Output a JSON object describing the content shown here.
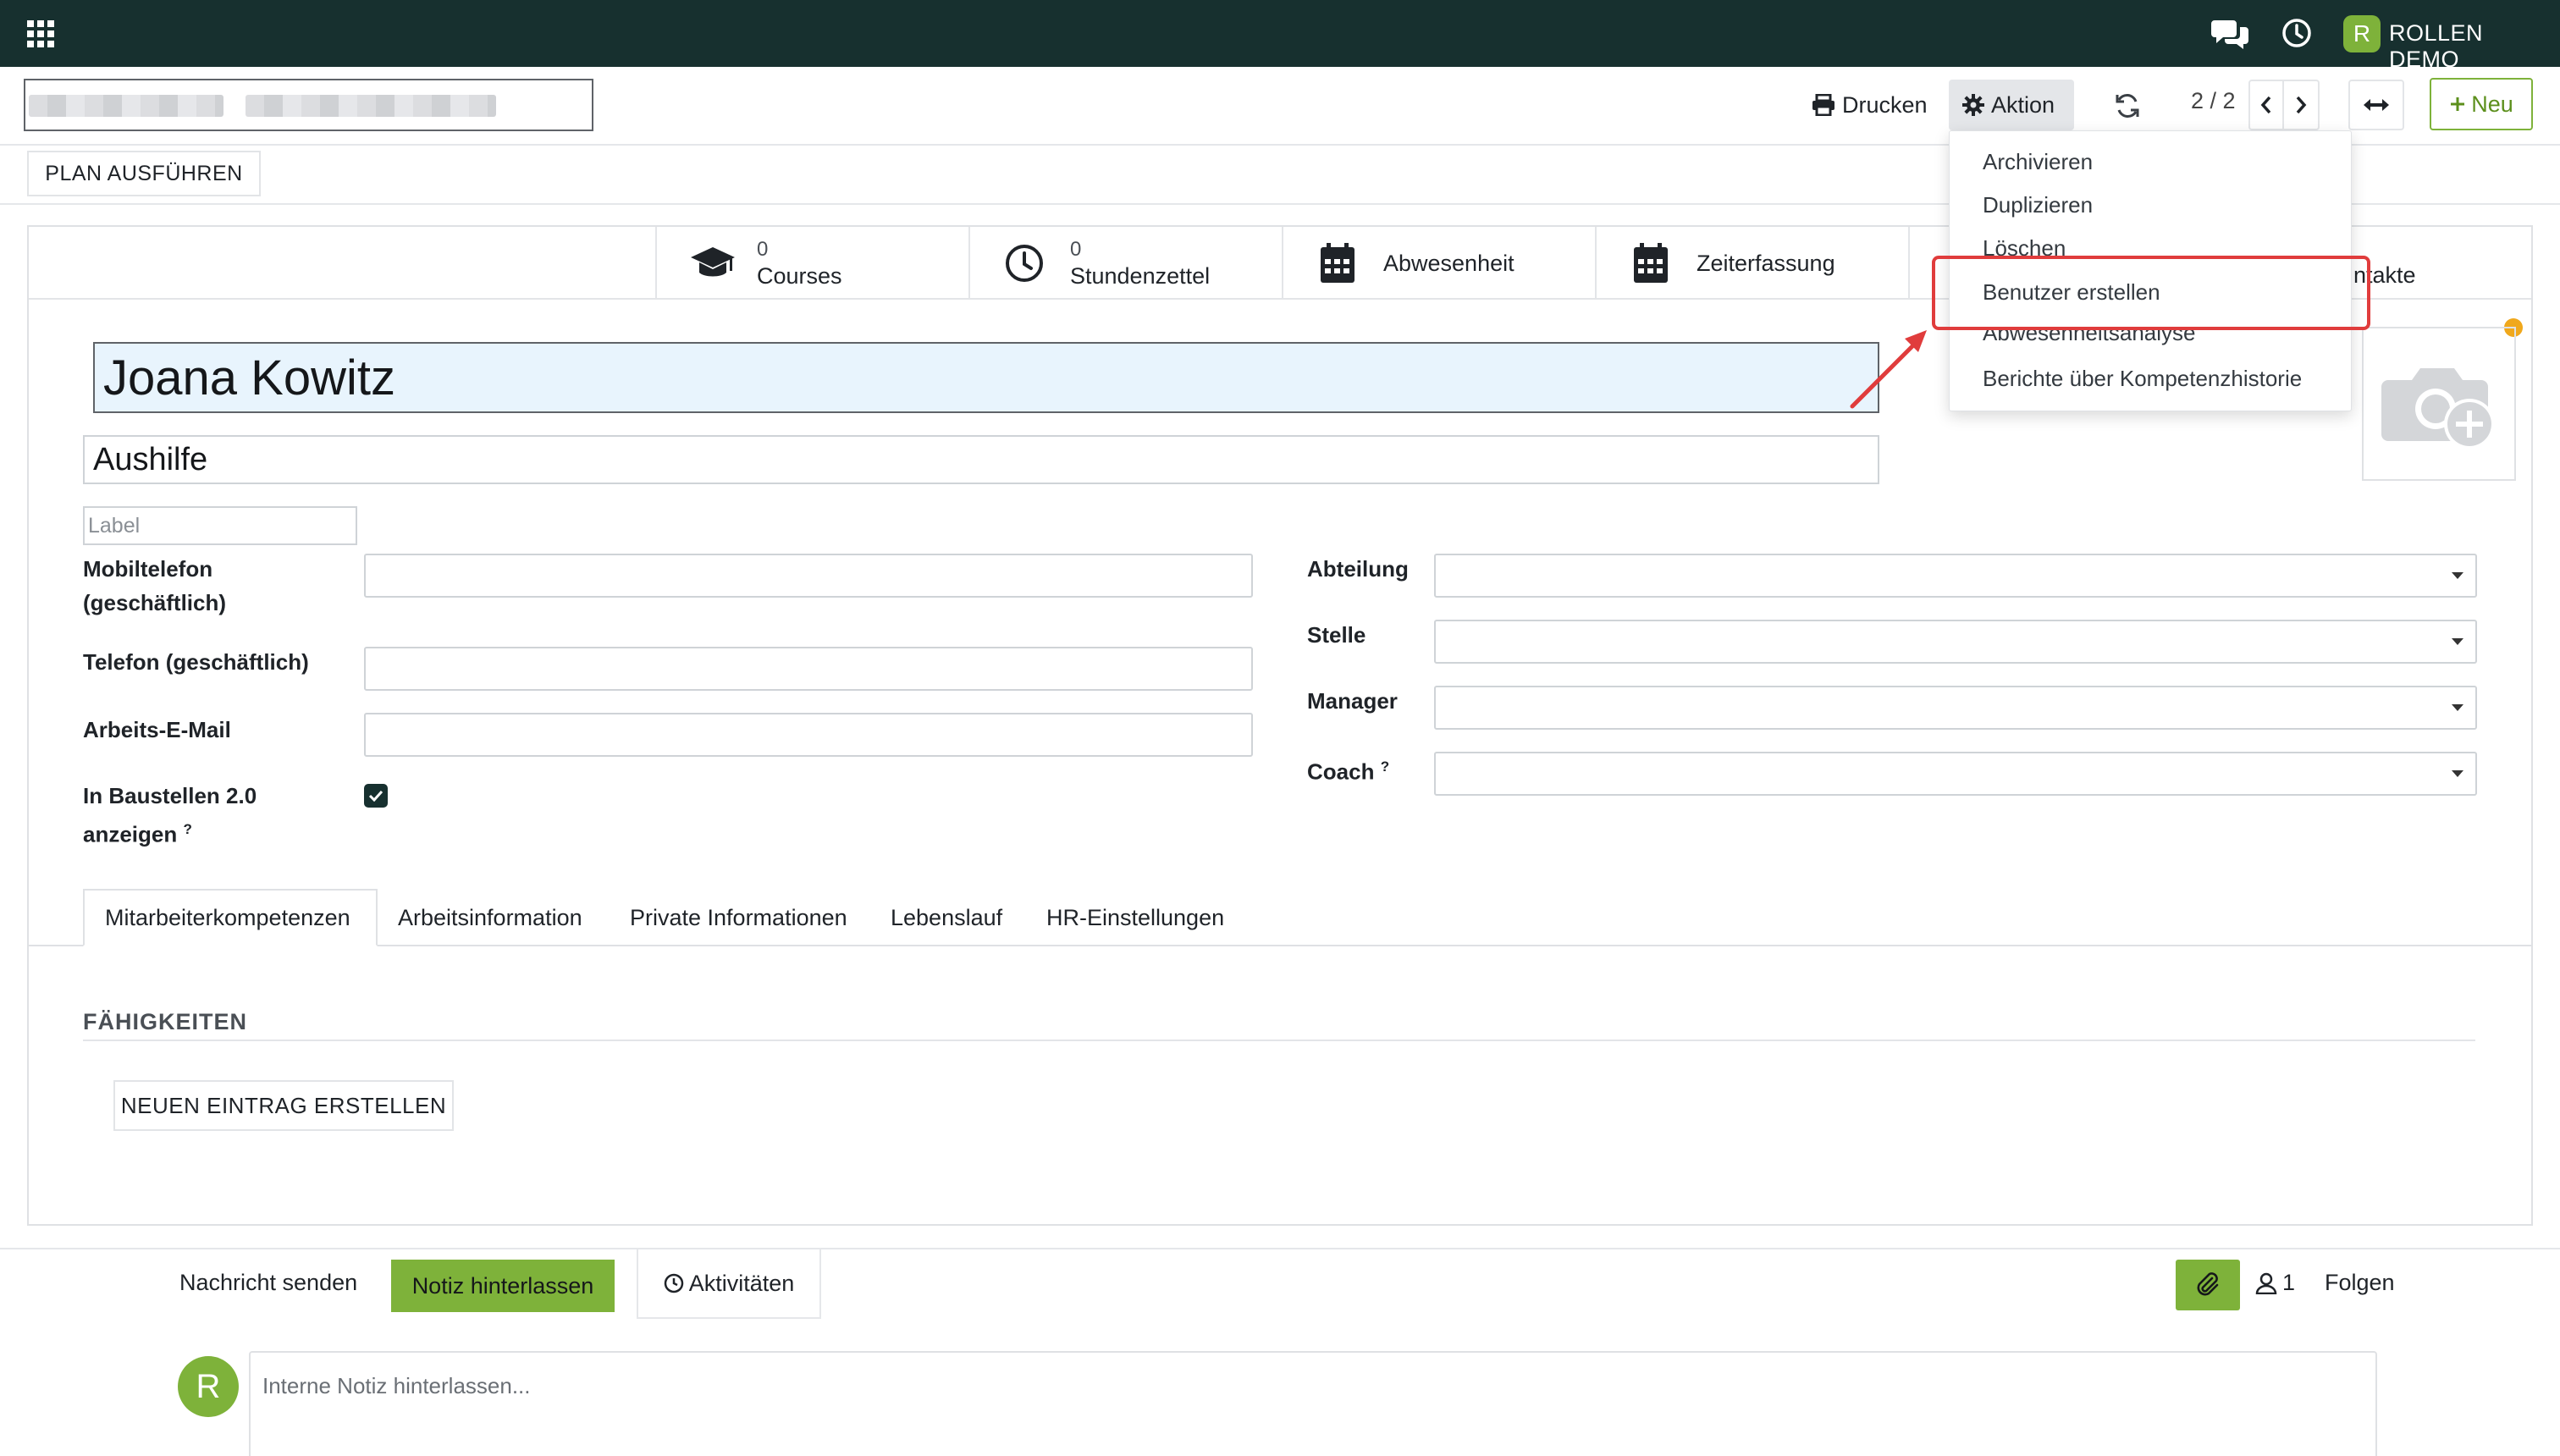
{
  "topbar": {
    "user_initial": "R",
    "user_name": "ROLLEN DEMO",
    "icons": [
      "apps-grid-icon",
      "chat-icon",
      "clock-icon"
    ]
  },
  "control_panel": {
    "print_label": "Drucken",
    "action_label": "Aktion",
    "pager_value": "2 / 2",
    "new_label": "Neu",
    "plan_button": "PLAN AUSFÜHREN"
  },
  "action_menu": {
    "items": [
      "Archivieren",
      "Duplizieren",
      "Löschen",
      "Benutzer erstellen",
      "Abwesenheitsanalyse",
      "Berichte über Kompetenzhistorie"
    ],
    "highlighted": "Benutzer erstellen"
  },
  "smart_buttons": [
    {
      "value": "0",
      "label": "Courses",
      "icon": "graduation-cap-icon"
    },
    {
      "value": "0",
      "label": "Stundenzettel",
      "icon": "clock-icon"
    },
    {
      "value": "",
      "label": "Abwesenheit",
      "icon": "calendar-icon"
    },
    {
      "value": "",
      "label": "Zeiterfassung",
      "icon": "calendar-icon"
    },
    {
      "value": "",
      "label": "ntakte",
      "icon": "contacts-icon"
    }
  ],
  "employee": {
    "name": "Joana Kowitz",
    "job_title": "Aushilfe",
    "label_placeholder": "Label"
  },
  "fields_left": [
    {
      "label_line1": "Mobiltelefon",
      "label_line2": "(geschäftlich)",
      "value": ""
    },
    {
      "label_line1": "Telefon (geschäftlich)",
      "value": ""
    },
    {
      "label_line1": "Arbeits-E-Mail",
      "value": ""
    },
    {
      "label_line1": "In Baustellen 2.0",
      "label_line2": "anzeigen",
      "help": "?",
      "checked": true
    }
  ],
  "fields_right": [
    {
      "label": "Abteilung",
      "value": ""
    },
    {
      "label": "Stelle",
      "value": ""
    },
    {
      "label": "Manager",
      "value": ""
    },
    {
      "label": "Coach",
      "help": "?",
      "value": ""
    }
  ],
  "tabs": [
    "Mitarbeiterkompetenzen",
    "Arbeitsinformation",
    "Private Informationen",
    "Lebenslauf",
    "HR-Einstellungen"
  ],
  "active_tab": "Mitarbeiterkompetenzen",
  "skills": {
    "title": "FÄHIGKEITEN",
    "new_entry": "NEUEN EINTRAG ERSTELLEN"
  },
  "chatter": {
    "send_message": "Nachricht senden",
    "log_note": "Notiz hinterlassen",
    "activities": "Aktivitäten",
    "followers_count": "1",
    "follow": "Folgen",
    "avatar_initial": "R",
    "composer_placeholder": "Interne Notiz hinterlassen..."
  },
  "colors": {
    "topbar": "#17302f",
    "accent_green": "#7eb23a",
    "highlight_red": "#e03c3c",
    "name_field_bg": "#e8f4fd"
  }
}
